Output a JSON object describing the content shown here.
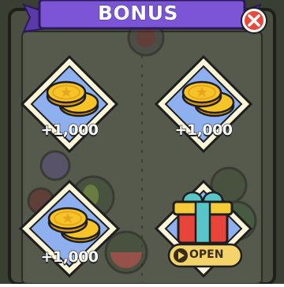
{
  "dialog": {
    "title": "BONUS",
    "close_icon": "close-icon"
  },
  "rewards": [
    {
      "amount": "+1,000",
      "icon": "gold-coins-icon"
    },
    {
      "amount": "+1,000",
      "icon": "gold-coins-icon"
    },
    {
      "amount": "+1,000",
      "icon": "gold-coins-icon"
    }
  ],
  "gift": {
    "icon": "gift-box-icon",
    "button_icon": "play-video-icon",
    "button_label": "OPEN"
  },
  "colors": {
    "board": "#3a3f34",
    "banner": "#7c55d6",
    "tile_fill": "#8fb0ee",
    "tile_border": "#fdf5d8",
    "coin": "#f7c428",
    "close": "#e64a3c",
    "gift_red": "#e8443a",
    "gift_teal": "#58c6c8",
    "button": "#f3d36a"
  }
}
